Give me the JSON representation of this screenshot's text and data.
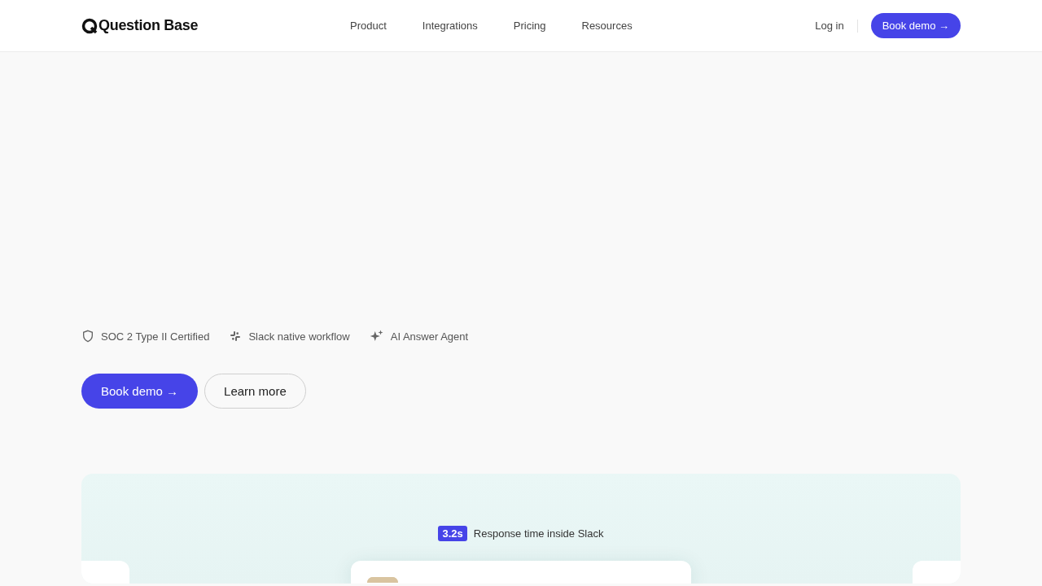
{
  "brand": {
    "name": "Question Base"
  },
  "nav": {
    "links": [
      "Product",
      "Integrations",
      "Pricing",
      "Resources"
    ],
    "login": "Log in",
    "cta": "Book demo →"
  },
  "features": [
    {
      "kind": "shield",
      "label": "SOC 2 Type II Certified"
    },
    {
      "kind": "slack",
      "label": "Slack native workflow"
    },
    {
      "kind": "sparkle",
      "label": "AI Answer Agent"
    }
  ],
  "actions": {
    "primary": "Book demo →",
    "secondary": "Learn more"
  },
  "showcase": {
    "badge": "3.2s",
    "caption": "Response time inside Slack"
  }
}
